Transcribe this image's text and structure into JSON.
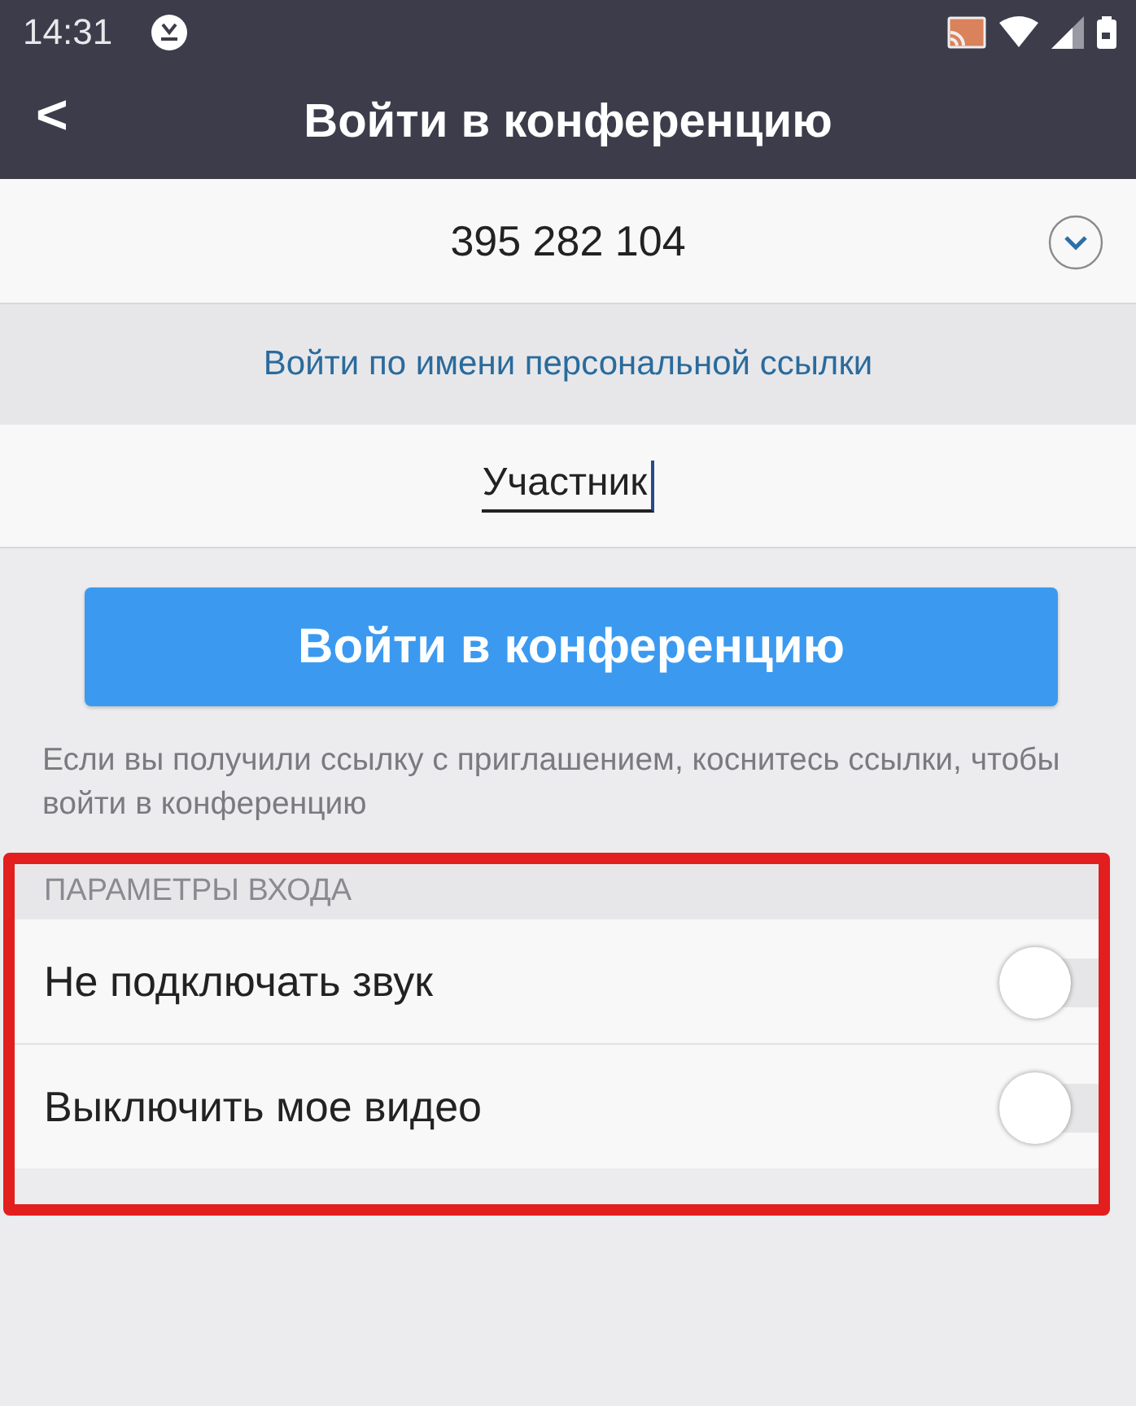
{
  "status_bar": {
    "time": "14:31"
  },
  "header": {
    "back": "<",
    "title": "Войти в конференцию"
  },
  "meeting_id": {
    "value": "395 282 104"
  },
  "link": "Войти по имени персональной ссылки",
  "name_field": {
    "value": "Участник"
  },
  "join_button": "Войти в конференцию",
  "hint": "Если вы получили ссылку с приглашением, коснитесь ссылки, чтобы войти в конференцию",
  "options": {
    "title": "ПАРАМЕТРЫ ВХОДА",
    "items": [
      {
        "label": "Не подключать звук",
        "on": false
      },
      {
        "label": "Выключить мое видео",
        "on": false
      }
    ]
  }
}
